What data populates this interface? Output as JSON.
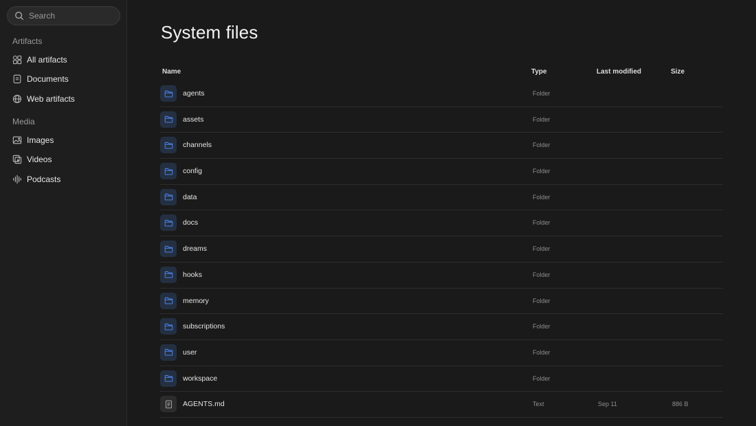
{
  "search": {
    "placeholder": "Search"
  },
  "sidebar": {
    "sections": [
      {
        "title": "Artifacts",
        "items": [
          {
            "label": "All artifacts",
            "icon": "grid-shapes-icon"
          },
          {
            "label": "Documents",
            "icon": "document-icon"
          },
          {
            "label": "Web artifacts",
            "icon": "globe-icon"
          }
        ]
      },
      {
        "title": "Media",
        "items": [
          {
            "label": "Images",
            "icon": "image-icon"
          },
          {
            "label": "Videos",
            "icon": "video-icon"
          },
          {
            "label": "Podcasts",
            "icon": "audio-wave-icon"
          }
        ]
      }
    ]
  },
  "main": {
    "title": "System files",
    "columns": {
      "name": "Name",
      "type": "Type",
      "modified": "Last modified",
      "size": "Size"
    },
    "rows": [
      {
        "name": "agents",
        "type": "Folder",
        "modified": "",
        "size": "",
        "icon": "folder-icon"
      },
      {
        "name": "assets",
        "type": "Folder",
        "modified": "",
        "size": "",
        "icon": "folder-icon"
      },
      {
        "name": "channels",
        "type": "Folder",
        "modified": "",
        "size": "",
        "icon": "folder-icon"
      },
      {
        "name": "config",
        "type": "Folder",
        "modified": "",
        "size": "",
        "icon": "folder-icon"
      },
      {
        "name": "data",
        "type": "Folder",
        "modified": "",
        "size": "",
        "icon": "folder-icon"
      },
      {
        "name": "docs",
        "type": "Folder",
        "modified": "",
        "size": "",
        "icon": "folder-icon"
      },
      {
        "name": "dreams",
        "type": "Folder",
        "modified": "",
        "size": "",
        "icon": "folder-icon"
      },
      {
        "name": "hooks",
        "type": "Folder",
        "modified": "",
        "size": "",
        "icon": "folder-icon"
      },
      {
        "name": "memory",
        "type": "Folder",
        "modified": "",
        "size": "",
        "icon": "folder-icon"
      },
      {
        "name": "subscriptions",
        "type": "Folder",
        "modified": "",
        "size": "",
        "icon": "folder-icon"
      },
      {
        "name": "user",
        "type": "Folder",
        "modified": "",
        "size": "",
        "icon": "folder-icon"
      },
      {
        "name": "workspace",
        "type": "Folder",
        "modified": "",
        "size": "",
        "icon": "folder-icon"
      },
      {
        "name": "AGENTS.md",
        "type": "Text",
        "modified": "Sep 11",
        "size": "886 B",
        "icon": "text-file-icon"
      }
    ]
  },
  "colors": {
    "background": "#1a1a1a",
    "sidebar": "#1e1e1e",
    "folder_accent": "#4a7fe0",
    "folder_tile": "#243042"
  }
}
